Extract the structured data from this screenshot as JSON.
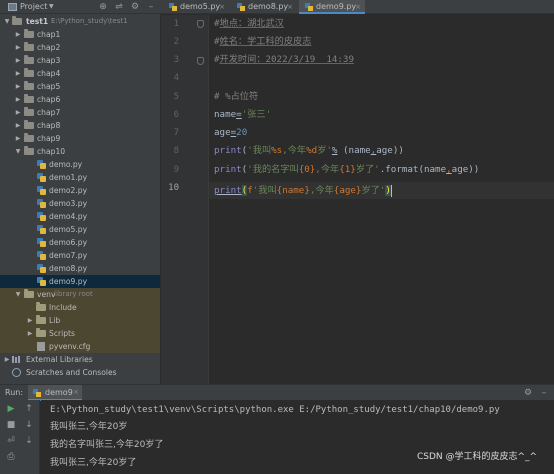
{
  "project_panel": {
    "title": "Project",
    "dropdown_icon": "chevron-down-icon",
    "tools": [
      "globe-icon",
      "collapse-icon",
      "gear-icon",
      "minimize-icon"
    ],
    "root": {
      "name": "test1",
      "path": "E:\\Python_study\\test1"
    },
    "folders": [
      "chap1",
      "chap2",
      "chap3",
      "chap4",
      "chap5",
      "chap6",
      "chap7",
      "chap8",
      "chap9",
      "chap10"
    ],
    "chap10_files": [
      "demo.py",
      "demo1.py",
      "demo2.py",
      "demo3.py",
      "demo4.py",
      "demo5.py",
      "demo6.py",
      "demo7.py",
      "demo8.py",
      "demo9.py"
    ],
    "selected_file": "demo9.py",
    "venv": {
      "label": "venv",
      "suffix": "library root",
      "children": [
        "Include",
        "Lib",
        "Scripts",
        "pyvenv.cfg"
      ]
    },
    "external_libraries": "External Libraries",
    "scratches": "Scratches and Consoles"
  },
  "tabs": [
    {
      "label": "demo5.py",
      "close": "×",
      "active": false
    },
    {
      "label": "demo8.py",
      "close": "×",
      "active": false
    },
    {
      "label": "demo9.py",
      "close": "×",
      "active": true
    }
  ],
  "editor": {
    "line_numbers": [
      "1",
      "2",
      "3",
      "4",
      "5",
      "6",
      "7",
      "8",
      "9",
      "10"
    ],
    "current_line": "10",
    "lines": {
      "l1": {
        "hash": "#",
        "text": "地点：湖北武汉"
      },
      "l2": {
        "hash": "#",
        "text": "姓名：学工科的皮皮志"
      },
      "l3": {
        "hash": "#",
        "text": "开发时间：2022/3/19  14:39"
      },
      "l5": {
        "comment": "# %占位符"
      },
      "l6": {
        "name": "name",
        "eq": "=",
        "value": "'张三'"
      },
      "l7": {
        "name": "age",
        "eq": "=",
        "value": "20"
      },
      "l8": {
        "fn": "print",
        "open": "(",
        "str1": "'我叫",
        "fmt1": "%s",
        "str2": ",今年",
        "fmt2": "%d",
        "str3": "岁'",
        "op": "%",
        "args": " (name",
        "comma": ",",
        "args2": "age))"
      },
      "l9": {
        "fn": "print",
        "open": "(",
        "str1": "'我的名字叫",
        "b1": "{0}",
        "str2": ",今年",
        "b2": "{1}",
        "str3": "岁了'",
        "call": ".format(name",
        "comma": ",",
        "args2": "age))"
      },
      "l10": {
        "fn": "print",
        "open": "(",
        "prefix": "f",
        "str1": "'我叫",
        "b1": "{name}",
        "str2": ",今年",
        "b2": "{age}",
        "str3": "岁了'",
        "close": ")"
      }
    }
  },
  "run_panel": {
    "label": "Run:",
    "tab": {
      "label": "demo9",
      "close": "×"
    },
    "toolbar": [
      "run-icon",
      "up-icon",
      "stop-icon",
      "down-icon",
      "wrap-icon",
      "scroll-icon",
      "print-icon"
    ],
    "output": [
      "E:\\Python_study\\test1\\venv\\Scripts\\python.exe E:/Python_study/test1/chap10/demo9.py",
      "我叫张三,今年20岁",
      "我的名字叫张三,今年20岁了",
      "我叫张三,今年20岁了"
    ]
  },
  "watermark": "CSDN @学工科的皮皮志^_^"
}
